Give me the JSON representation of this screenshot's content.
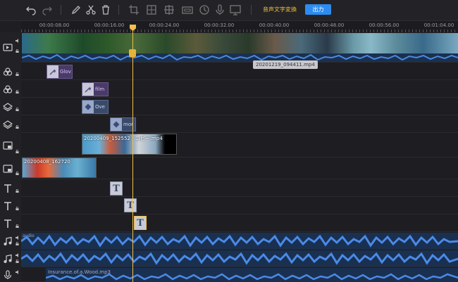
{
  "toolbar": {
    "icons": [
      "undo-icon",
      "redo-icon",
      "pen-icon",
      "scissors-icon",
      "trash-icon",
      "crop-icon",
      "split-icon",
      "mosaic-icon",
      "frame-icon",
      "speed-icon",
      "mic-icon",
      "screen-icon"
    ],
    "speech_to_text_label": "音声文字変換",
    "export_label": "出力",
    "accent_color": "#2d8cf0",
    "highlight_color": "#f0c040"
  },
  "ruler": {
    "ticks": [
      "00:00:08.00",
      "00:00:16.00",
      "00:00:24.00",
      "00:00:32.00",
      "00:00:40.00",
      "00:00:48.00",
      "00:00:56.00",
      "00:01:04.00"
    ]
  },
  "tracks": {
    "main_video": {
      "tooltip": "20201219_094411.mp4"
    },
    "effect1": {
      "label": "Glov"
    },
    "effect2": {
      "label": "film"
    },
    "overlay1": {
      "label": "Ove"
    },
    "overlay2": {
      "label": "mor"
    },
    "pip1": {
      "label": "20200409_152552 - コピー.mp4"
    },
    "pip2": {
      "label": "20200408_162720"
    },
    "text1": {
      "glyph": "T"
    },
    "text2": {
      "glyph": "T"
    },
    "text3": {
      "glyph": "T"
    },
    "audio1": {
      "label": "audio"
    },
    "voice": {
      "label": "Insurance.of.a.Wood.mp3"
    }
  }
}
